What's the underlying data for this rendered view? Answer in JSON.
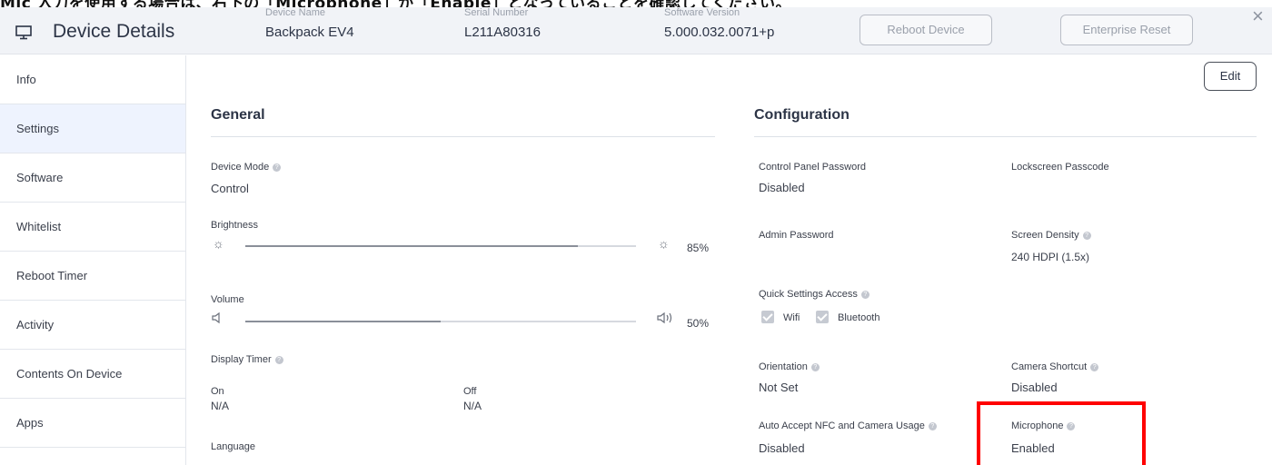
{
  "caption": "Mic 入力を使用する場合は、右下の「Microphone」が「Enable」となっていることを確認してください。",
  "header": {
    "title": "Device Details",
    "device_name_label": "Device Name",
    "device_name": "Backpack EV4",
    "serial_label": "Serial Number",
    "serial": "L211A80316",
    "software_label": "Software Version",
    "software": "5.000.032.0071+p",
    "reboot_button": "Reboot Device",
    "reset_button": "Enterprise Reset",
    "close": "×"
  },
  "sidebar": {
    "active": "Settings",
    "items": [
      {
        "label": "Info"
      },
      {
        "label": "Settings"
      },
      {
        "label": "Software"
      },
      {
        "label": "Whitelist"
      },
      {
        "label": "Reboot Timer"
      },
      {
        "label": "Activity"
      },
      {
        "label": "Contents On Device"
      },
      {
        "label": "Apps"
      }
    ]
  },
  "edit_button": "Edit",
  "general": {
    "title": "General",
    "device_mode_label": "Device Mode",
    "device_mode": "Control",
    "brightness_label": "Brightness",
    "brightness_value": "85%",
    "brightness_level": 0.85,
    "volume_label": "Volume",
    "volume_value": "50%",
    "volume_level": 0.5,
    "display_timer_label": "Display Timer",
    "on_label": "On",
    "on_value": "N/A",
    "off_label": "Off",
    "off_value": "N/A",
    "language_label": "Language"
  },
  "configuration": {
    "title": "Configuration",
    "control_panel_password_label": "Control Panel Password",
    "control_panel_password": "Disabled",
    "lockscreen_passcode_label": "Lockscreen Passcode",
    "admin_password_label": "Admin Password",
    "screen_density_label": "Screen Density",
    "screen_density": "240 HDPI (1.5x)",
    "quick_settings_label": "Quick Settings Access",
    "wifi_label": "Wifi",
    "wifi_checked": true,
    "bluetooth_label": "Bluetooth",
    "bluetooth_checked": true,
    "orientation_label": "Orientation",
    "orientation": "Not Set",
    "camera_shortcut_label": "Camera Shortcut",
    "camera_shortcut": "Disabled",
    "auto_accept_label": "Auto Accept NFC and Camera Usage",
    "auto_accept": "Disabled",
    "microphone_label": "Microphone",
    "microphone": "Enabled"
  },
  "colors": {
    "accent": "#eef3fe",
    "highlight": "#ff0000"
  }
}
